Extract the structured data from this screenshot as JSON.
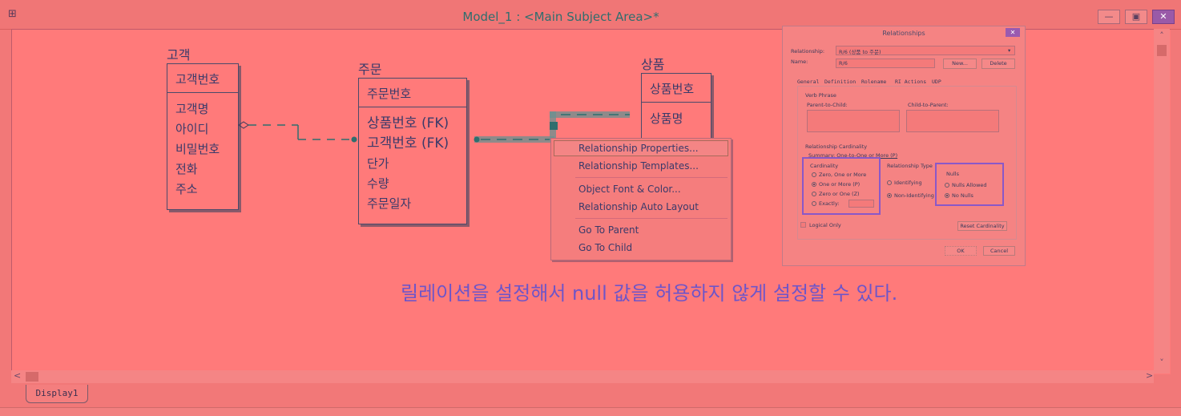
{
  "window": {
    "title": "Model_1 : <Main Subject Area>*",
    "minimize_label": "—",
    "restore_label": "▣",
    "close_label": "✕"
  },
  "tab_label": "Display1",
  "entities": {
    "customer": {
      "title": "고객",
      "key": "고객번호",
      "attrs": [
        "고객명",
        "아이디",
        "비밀번호",
        "전화",
        "주소"
      ]
    },
    "order": {
      "title": "주문",
      "key": "주문번호",
      "attrs": [
        "상품번호 (FK)",
        "고객번호 (FK)",
        "단가",
        "수량",
        "주문일자"
      ]
    },
    "product": {
      "title": "상품",
      "key": "상품번호",
      "attrs": [
        "상품명"
      ]
    }
  },
  "context_menu": {
    "items": [
      "Relationship Properties...",
      "Relationship Templates...",
      "Object Font & Color...",
      "Relationship Auto Layout",
      "Go To Parent",
      "Go To Child"
    ]
  },
  "dialog": {
    "title": "Relationships",
    "relationship_label": "Relationship:",
    "relationship_value": "R/6 (상품 to 주문)",
    "name_label": "Name:",
    "name_value": "R/6",
    "new_button": "New...",
    "delete_button": "Delete",
    "tabs": [
      "General",
      "Definition",
      "Rolename",
      "RI Actions",
      "UDP"
    ],
    "verb_phrase": "Verb Phrase",
    "parent_to_child": "Parent-to-Child:",
    "child_to_parent": "Child-to-Parent:",
    "cardinality_section": "Relationship Cardinality",
    "summary": "Summary: One-to-One or More (P)",
    "cardinality_group": "Cardinality",
    "cardinality_options": [
      "Zero, One or More",
      "One or More (P)",
      "Zero or One (Z)",
      "Exactly:"
    ],
    "type_group": "Relationship Type",
    "type_options": [
      "Identifying",
      "Non-Identifying"
    ],
    "nulls_group": "Nulls",
    "nulls_options": [
      "Nulls Allowed",
      "No Nulls"
    ],
    "logical_only": "Logical Only",
    "reset_cardinality": "Reset Cardinality",
    "ok": "OK",
    "cancel": "Cancel"
  },
  "caption": "릴레이션을 설정해서 null 값을 허용하지 않게 설정할 수 있다.",
  "colors": {
    "background": "#ff7a7a",
    "caption": "#6e55c8",
    "highlight": "#8a58c8",
    "teal": "#2f6e6e"
  }
}
